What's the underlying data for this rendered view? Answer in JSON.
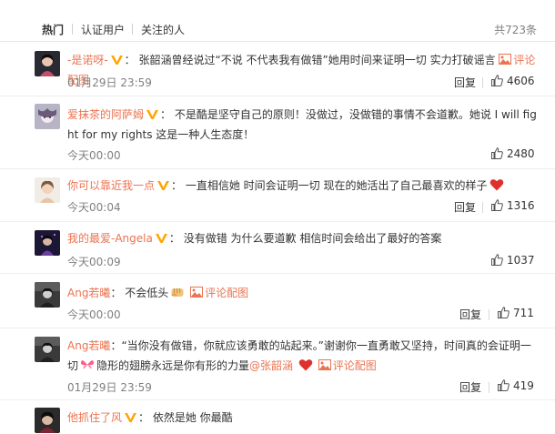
{
  "tabs": [
    {
      "label": "热门"
    },
    {
      "label": "认证用户"
    },
    {
      "label": "关注的人"
    }
  ],
  "total": "共723条",
  "actions": {
    "reply_label": "回复"
  },
  "comments": [
    {
      "username": "-是诺呀-",
      "sep": "：",
      "text": "张韶涵曾经说过“不说 不代表我有做错”她用时间来证明一切 实力打破谣言",
      "pic_link": "评论配图",
      "time": "01月29日 23:59",
      "likes": "4606"
    },
    {
      "username": "爱抹茶的阿萨姆",
      "sep": "：",
      "text": "不是酷是坚守自己的原则！没做过，没做错的事情不会道歉。她说 I will fight for my rights 这是一种人生态度！",
      "time": "今天00:00",
      "likes": "2480"
    },
    {
      "username": "你可以靠近我一点",
      "sep": "：",
      "text": "一直相信她 时间会证明一切 现在的她活出了自己最喜欢的样子",
      "time": "今天00:04",
      "likes": "1316"
    },
    {
      "username": "我的最爱-Angela",
      "sep": "：",
      "text": "没有做错 为什么要道歉 相信时间会给出了最好的答案",
      "time": "今天00:09",
      "likes": "1037"
    },
    {
      "username": "Ang若曦",
      "sep": "：",
      "text": "不会低头",
      "pic_link": "评论配图",
      "time": "今天00:00",
      "likes": "711"
    },
    {
      "username": "Ang若曦",
      "sep": "：",
      "text": "“当你没有做错，你就应该勇敢的站起来。”谢谢你一直勇敢又坚持，时间真的会证明一切",
      "text2": "隐形的翅膀永远是你有形的力量",
      "mention": "@张韶涵",
      "pic_link": "评论配图",
      "time": "01月29日 23:59",
      "likes": "419"
    },
    {
      "username": "他抓住了风",
      "sep": "：",
      "text": "依然是她 你最酷"
    }
  ],
  "colors": {
    "link": "#eb7350",
    "vbadge": "#ffa500",
    "muted": "#808080",
    "heart": "#e0302e"
  },
  "icons": [
    "thumbs-up-icon",
    "verified-badge-icon",
    "picture-icon",
    "heart-emoji-icon",
    "fist-emoji-icon",
    "butterfly-emoji-icon"
  ]
}
